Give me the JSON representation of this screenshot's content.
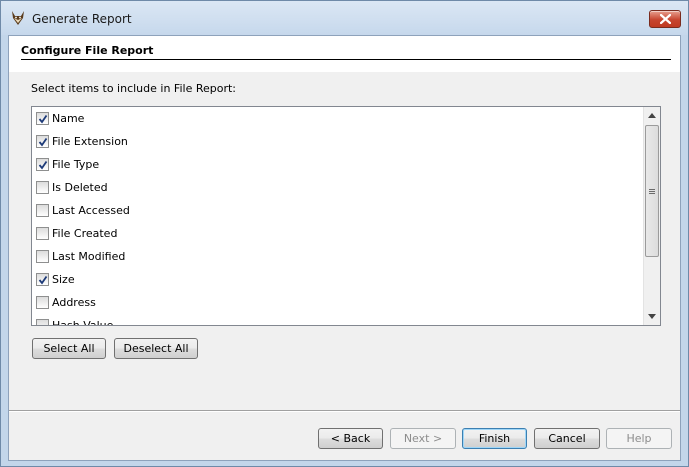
{
  "window": {
    "title": "Generate Report"
  },
  "header": {
    "title": "Configure File Report"
  },
  "prompt": "Select items to include in File Report:",
  "items": [
    {
      "label": "Name",
      "checked": true
    },
    {
      "label": "File Extension",
      "checked": true
    },
    {
      "label": "File Type",
      "checked": true
    },
    {
      "label": "Is Deleted",
      "checked": false
    },
    {
      "label": "Last Accessed",
      "checked": false
    },
    {
      "label": "File Created",
      "checked": false
    },
    {
      "label": "Last Modified",
      "checked": false
    },
    {
      "label": "Size",
      "checked": true
    },
    {
      "label": "Address",
      "checked": false
    },
    {
      "label": "Hash Value",
      "checked": false
    }
  ],
  "list_buttons": {
    "select_all": "Select All",
    "deselect_all": "Deselect All"
  },
  "nav": {
    "back": "< Back",
    "next": "Next >",
    "finish": "Finish",
    "cancel": "Cancel",
    "help": "Help"
  },
  "icons": {
    "app": "fox-head-icon",
    "close": "close-icon",
    "check": "checkmark-icon"
  },
  "colors": {
    "accent": "#3c7fb1",
    "close_red": "#c7452f",
    "title_bar": "#c6d8ec"
  }
}
